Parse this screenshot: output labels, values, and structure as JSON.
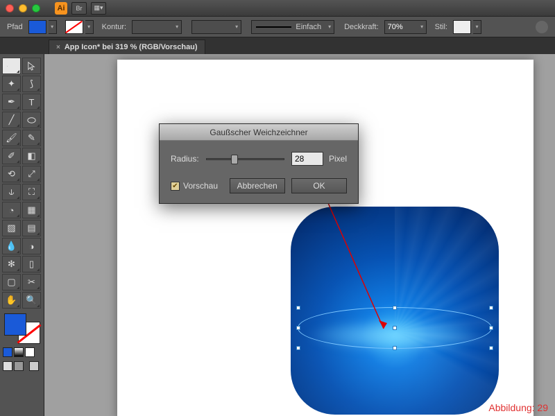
{
  "titlebar": {
    "app_abbrev": "Ai",
    "br_label": "Br"
  },
  "control_bar": {
    "path_label": "Pfad",
    "stroke_label": "Kontur:",
    "stroke_style_selected": "Einfach",
    "opacity_label": "Deckkraft:",
    "opacity_value": "70%",
    "style_label": "Stil:",
    "colors": {
      "fill": "#1a5ad8"
    }
  },
  "tab": {
    "title": "App Icon* bei 319 % (RGB/Vorschau)"
  },
  "dialog": {
    "title": "Gaußscher Weichzeichner",
    "radius_label": "Radius:",
    "radius_value": "28",
    "radius_unit": "Pixel",
    "preview_label": "Vorschau",
    "preview_checked": true,
    "cancel": "Abbrechen",
    "ok": "OK"
  },
  "caption": "Abbildung: 29"
}
